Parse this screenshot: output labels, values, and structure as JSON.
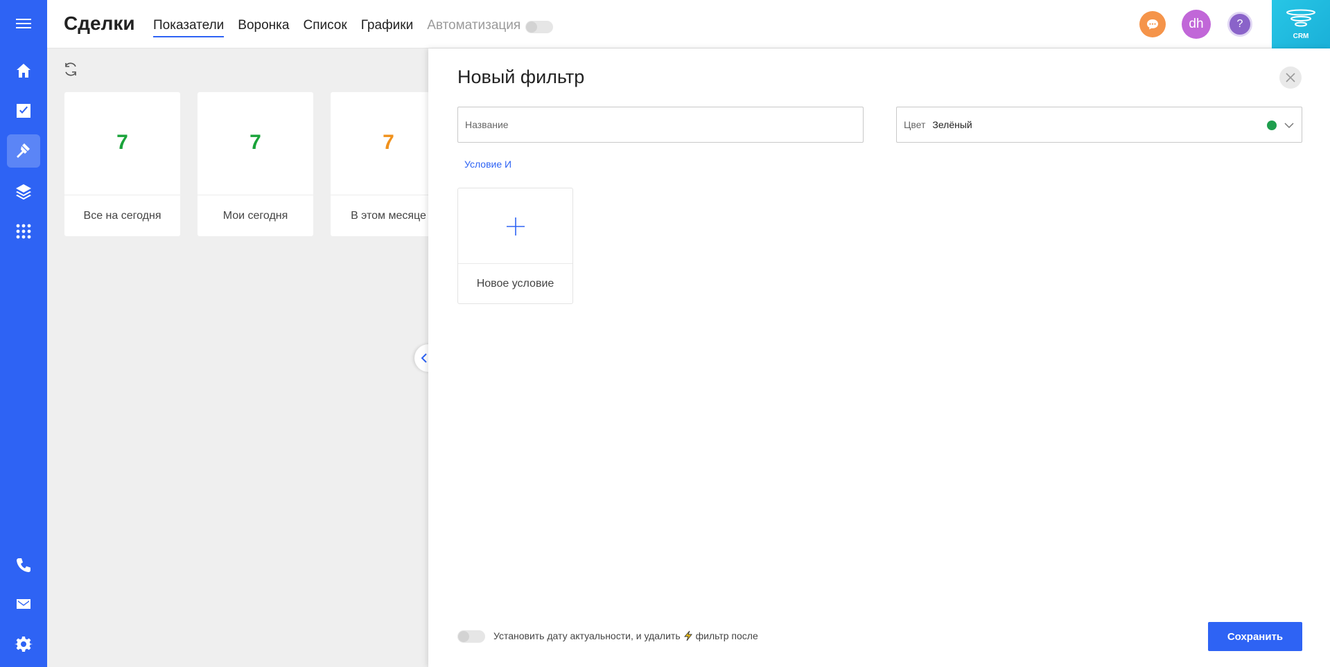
{
  "header": {
    "title": "Сделки",
    "tabs": [
      {
        "label": "Показатели",
        "state": "active"
      },
      {
        "label": "Воронка",
        "state": "normal"
      },
      {
        "label": "Список",
        "state": "normal"
      },
      {
        "label": "Графики",
        "state": "normal"
      },
      {
        "label": "Автоматизация",
        "state": "disabled"
      }
    ],
    "avatar_initials": "dh",
    "help_glyph": "?",
    "crm_label": "CRM"
  },
  "sidebar": {
    "items": [
      "menu-icon",
      "home-icon",
      "tasks-icon",
      "deals-icon",
      "layers-icon",
      "apps-icon",
      "phone-icon",
      "mail-icon",
      "settings-icon"
    ],
    "active": "deals-icon"
  },
  "kpis": [
    {
      "value": "7",
      "label": "Все на сегодня",
      "color": "#1aa33a"
    },
    {
      "value": "7",
      "label": "Мои сегодня",
      "color": "#1aa33a"
    },
    {
      "value": "7",
      "label": "В этом месяце",
      "color": "#f0911c"
    }
  ],
  "panel": {
    "title": "Новый фильтр",
    "name_placeholder": "Название",
    "color_label": "Цвет",
    "color_value": "Зелёный",
    "color_swatch": "#1f9e4e",
    "condition_link": "Условие И",
    "new_condition_label": "Новое условие",
    "footer_text_before": "Установить дату актуальности, и удалить",
    "footer_text_after": "фильтр после",
    "save_label": "Сохранить"
  },
  "colors": {
    "accent": "#2e63f4",
    "chat": "#f5944a",
    "avatar": "#c167d8",
    "help": "#8a63c9"
  }
}
